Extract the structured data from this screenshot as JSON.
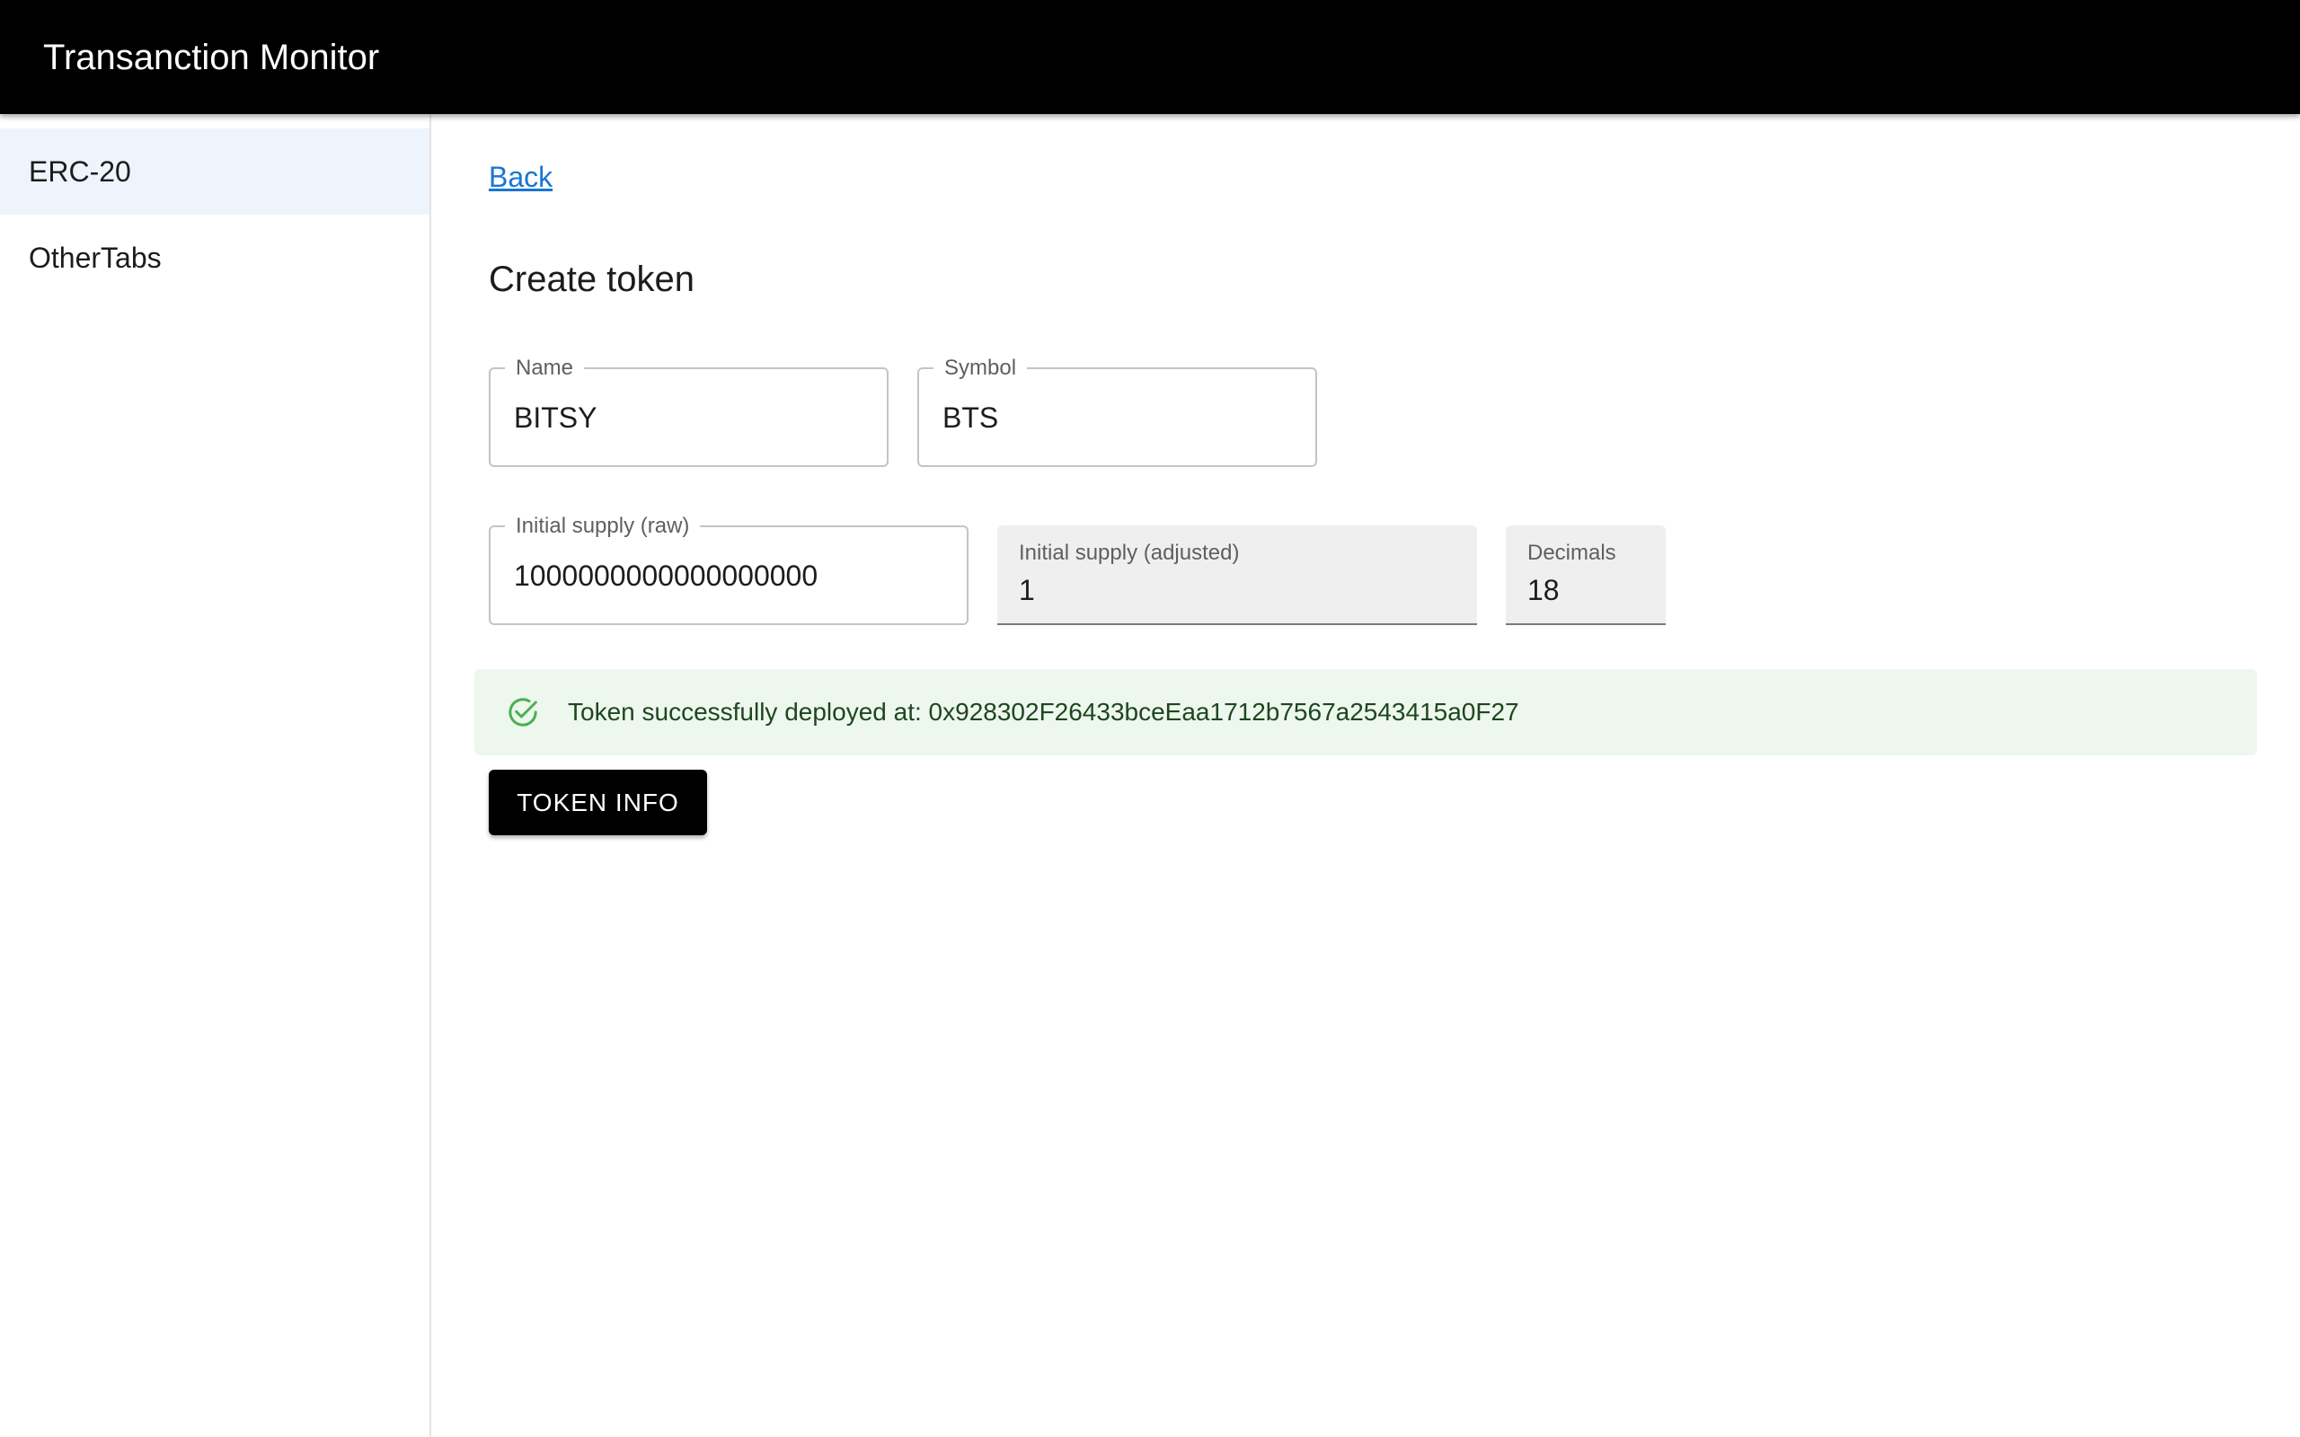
{
  "app": {
    "title": "Transanction Monitor"
  },
  "sidebar": {
    "items": [
      {
        "label": "ERC-20",
        "selected": true
      },
      {
        "label": "OtherTabs",
        "selected": false
      }
    ]
  },
  "main": {
    "back_label": "Back",
    "title": "Create token",
    "fields": {
      "name": {
        "label": "Name",
        "value": "BITSY"
      },
      "symbol": {
        "label": "Symbol",
        "value": "BTS"
      },
      "supply_raw": {
        "label": "Initial supply (raw)",
        "value": "1000000000000000000"
      },
      "supply_adjusted": {
        "label": "Initial supply (adjusted)",
        "value": "1"
      },
      "decimals": {
        "label": "Decimals",
        "value": "18"
      }
    },
    "alert": {
      "icon": "check-circle-icon",
      "severity": "success",
      "text": "Token successfully deployed at: 0x928302F26433bceEaa1712b7567a2543415a0F27"
    },
    "token_info_button": "TOKEN INFO"
  },
  "colors": {
    "appbar": "#000000",
    "link": "#1976d2",
    "sidebar_selected": "#edf4fc",
    "success_bg": "#edf7ed",
    "success_icon": "#4caf50",
    "success_text": "#1e4620",
    "button": "#000000"
  }
}
